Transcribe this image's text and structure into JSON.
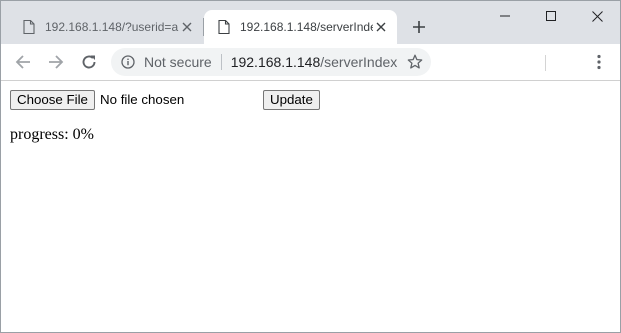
{
  "tabs": [
    {
      "title": "192.168.1.148/?userid=a",
      "active": false
    },
    {
      "title": "192.168.1.148/serverIndex",
      "active": true
    }
  ],
  "icons": {
    "tab_page": "document-icon",
    "tab_close": "close-icon",
    "new_tab": "plus-icon",
    "minimize": "minimize-icon",
    "maximize": "maximize-icon",
    "window_close": "close-icon",
    "back": "arrow-left-icon",
    "forward": "arrow-right-icon",
    "reload": "reload-icon",
    "site_info": "info-icon",
    "bookmark": "star-icon",
    "menu": "kebab-menu-icon"
  },
  "omnibox": {
    "security": "Not secure",
    "host": "192.168.1.148",
    "path": "/serverIndex"
  },
  "page": {
    "choose_file_label": "Choose File",
    "file_status": "No file chosen",
    "update_label": "Update",
    "progress_text": "progress: 0%"
  },
  "colors": {
    "tabstrip_bg": "#dee1e6",
    "omnibox_bg": "#f1f3f4",
    "text_muted": "#5f6368",
    "button_bg": "#efefef"
  }
}
